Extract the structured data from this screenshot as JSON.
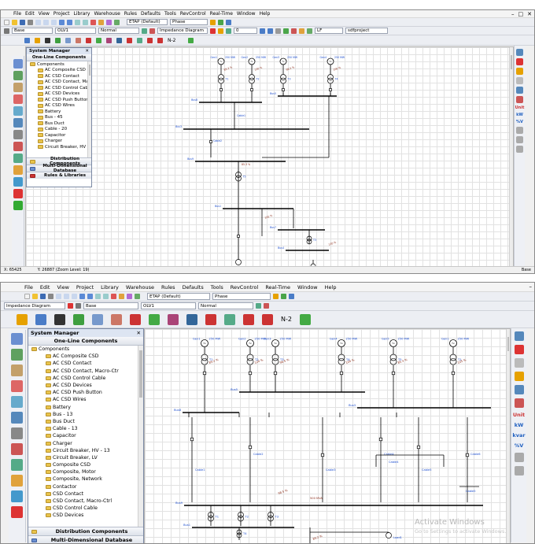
{
  "menu": [
    "File",
    "Edit",
    "View",
    "Project",
    "Library",
    "Warehouse",
    "Rules",
    "Defaults",
    "Tools",
    "RevControl",
    "Real-Time",
    "Window",
    "Help"
  ],
  "toolbar1": {
    "project_combo": "ETAP (Default)",
    "phase_combo": "Phase",
    "base_combo": "Base",
    "olv_combo": "OLV1",
    "normal_combo": "Normal",
    "study_combo": "Impedance Diagram",
    "zero_combo": "0",
    "lf_combo": "LF",
    "project_name": "sdfproject",
    "n2_label": "N-2"
  },
  "system_manager": {
    "title": "System Manager",
    "header": "One-Line Components",
    "tree_top": [
      "Components",
      "AC Composite CSD",
      "AC CSD Contact",
      "AC CSD Contact, Ma",
      "AC CSD Control Cab",
      "AC CSD Devices",
      "AC CSD Push Button",
      "AC CSD Wires",
      "Battery",
      "Bus - 45",
      "Bus Duct",
      "Cable - 20",
      "Capacitor",
      "Charger",
      "Circuit Breaker, HV"
    ],
    "tree_bottom": [
      "Components",
      "AC Composite CSD",
      "AC CSD Contact",
      "AC CSD Contact, Macro-Ctr",
      "AC CSD Control Cable",
      "AC CSD Devices",
      "AC CSD Push Button",
      "AC CSD Wires",
      "Battery",
      "Bus - 13",
      "Bus Duct",
      "Cable - 13",
      "Capacitor",
      "Charger",
      "Circuit Breaker, HV - 13",
      "Circuit Breaker, LV",
      "Composite CSD",
      "Composite, Motor",
      "Composite, Network",
      "Contactor",
      "CSD Contact",
      "CSD Contact, Macro-Ctrl",
      "CSD Control Cable",
      "CSD Devices"
    ],
    "sections_top": [
      "Distribution Components",
      "Multi-Dimensional Database",
      "Rules & Libraries"
    ],
    "sections_bottom": [
      "Distribution Components",
      "Multi-Dimensional Database"
    ]
  },
  "status": {
    "x": "X: 65425",
    "y": "Y: 26887 (Zoom Level: 19)",
    "right": "Base"
  },
  "right_toolbar": {
    "unit_label": "Unit",
    "kw_label": "kW",
    "kvar_label": "kvar",
    "v_label": "%V"
  },
  "watermark": {
    "title": "Activate Windows",
    "subtitle": "Go to Settings to activate Windows."
  },
  "colors": {
    "accent": "#1f5fbf",
    "grid": "#e2e2e2",
    "line": "#000000",
    "label": "#1a4ccf",
    "flow": "#8b2d1a"
  },
  "diagram_labels": {
    "bus": [
      "Bus8",
      "Bus5",
      "Bus3",
      "Bus9",
      "Bus1",
      "Bus7",
      "Bus4"
    ],
    "gen": [
      "Gen1",
      "Gen2",
      "Gen3",
      "Gen4",
      "Gen5"
    ],
    "xfmr": [
      "T1",
      "T2",
      "T3",
      "T4",
      "T5"
    ],
    "rating": [
      "250 MW",
      "100 MW",
      "500 MVA",
      "10 kV"
    ],
    "flow": [
      "89.2 %",
      "120 %",
      "98.5 %",
      "100 %",
      "85.3 %",
      "105 %"
    ],
    "cable": [
      "Cable1",
      "Cable2",
      "Cable3",
      "Cable4",
      "Cable5",
      "Cable6"
    ],
    "load": [
      "Lump1",
      "Lump2",
      "Load1"
    ]
  }
}
